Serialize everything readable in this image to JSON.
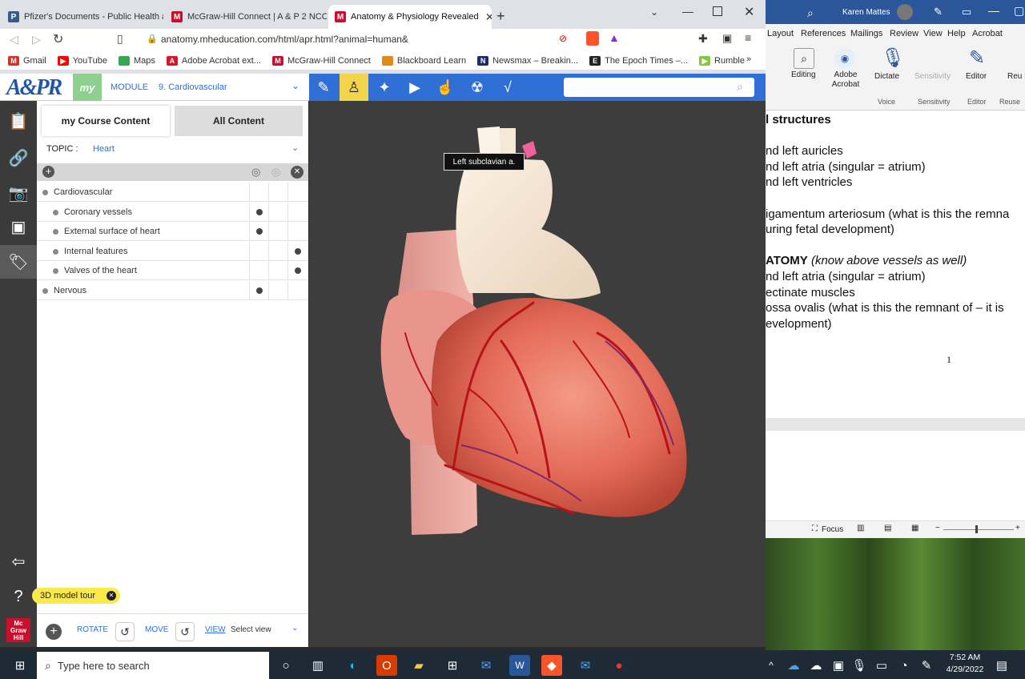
{
  "browser": {
    "tabs": [
      {
        "title": "Pfizer's Documents - Public Health an",
        "favicon": "P",
        "color": "#3a5a8c"
      },
      {
        "title": "McGraw-Hill Connect | A & P 2 NCC S",
        "favicon": "M",
        "color": "#c8102e"
      },
      {
        "title": "Anatomy & Physiology Revealed",
        "favicon": "M",
        "color": "#c8102e",
        "active": true
      }
    ],
    "new_tab": "+",
    "url": "anatomy.mheducation.com/html/apr.html?animal=human&",
    "bookmarks": [
      {
        "label": "Gmail",
        "color": "#d93025"
      },
      {
        "label": "YouTube",
        "color": "#ff0000"
      },
      {
        "label": "Maps",
        "color": "#34a853"
      },
      {
        "label": "Adobe Acrobat ext...",
        "color": "#d4152b"
      },
      {
        "label": "McGraw-Hill Connect",
        "color": "#c8102e"
      },
      {
        "label": "Blackboard Learn",
        "color": "#e08a1b"
      },
      {
        "label": "Newsmax – Breakin...",
        "color": "#1a2b6b"
      },
      {
        "label": "The Epoch Times –...",
        "color": "#222222"
      },
      {
        "label": "Rumble",
        "color": "#85c742"
      }
    ],
    "more": "»"
  },
  "app": {
    "logo": "A&PR",
    "my": "my",
    "module_label": "MODULE",
    "module_value": "9. Cardiovascular",
    "tab_my": "my Course Content",
    "tab_all": "All Content",
    "topic_label": "TOPIC :",
    "topic_value": "Heart",
    "tree": [
      {
        "label": "Cardiovascular",
        "level": 0,
        "marks": [
          false,
          false,
          false
        ]
      },
      {
        "label": "Coronary vessels",
        "level": 1,
        "marks": [
          true,
          false,
          false
        ]
      },
      {
        "label": "External surface of heart",
        "level": 1,
        "marks": [
          true,
          false,
          false
        ]
      },
      {
        "label": "Internal features",
        "level": 1,
        "marks": [
          false,
          false,
          true
        ]
      },
      {
        "label": "Valves of the heart",
        "level": 1,
        "marks": [
          false,
          false,
          true
        ]
      },
      {
        "label": "Nervous",
        "level": 0,
        "marks": [
          true,
          false,
          false
        ]
      }
    ],
    "tour": "3D model tour",
    "rotate": "ROTATE",
    "move": "MOVE",
    "view": "VIEW",
    "view_select": "Select view",
    "tooltip": "Left subclavian a.",
    "brand_mini": "Mc Graw Hill"
  },
  "word": {
    "user": "Karen Mattes",
    "tabs": [
      "Layout",
      "References",
      "Mailings",
      "Review",
      "View",
      "Help",
      "Acrobat"
    ],
    "ribbon": [
      {
        "label": "Editing",
        "group": ""
      },
      {
        "label": "Adobe Acrobat",
        "group": ""
      },
      {
        "label": "Dictate",
        "group": "Voice"
      },
      {
        "label": "Sensitivity",
        "group": "Sensitivity"
      },
      {
        "label": "Editor",
        "group": "Editor"
      },
      {
        "label": "Reu File",
        "group": "Reuse"
      }
    ],
    "doc_lines": [
      {
        "text": "l structures",
        "bold": true
      },
      {
        "text": ""
      },
      {
        "text": "nd left auricles"
      },
      {
        "text": "nd left atria (singular = atrium)"
      },
      {
        "text": "nd left ventricles"
      },
      {
        "text": ""
      },
      {
        "text": "igamentum arteriosum (what is this the remna"
      },
      {
        "text": "uring fetal development)"
      },
      {
        "text": ""
      },
      {
        "text": "ATOMY",
        "bold": true,
        "suffix": " (know above vessels as well)"
      },
      {
        "text": "nd left atria (singular = atrium)"
      },
      {
        "text": "ectinate muscles"
      },
      {
        "text": "ossa ovalis (what is this the remnant of – it is"
      },
      {
        "text": "evelopment)"
      }
    ],
    "page_number": "1",
    "focus": "Focus"
  },
  "taskbar": {
    "search_placeholder": "Type here to search",
    "time": "7:52 AM",
    "date": "4/29/2022"
  }
}
